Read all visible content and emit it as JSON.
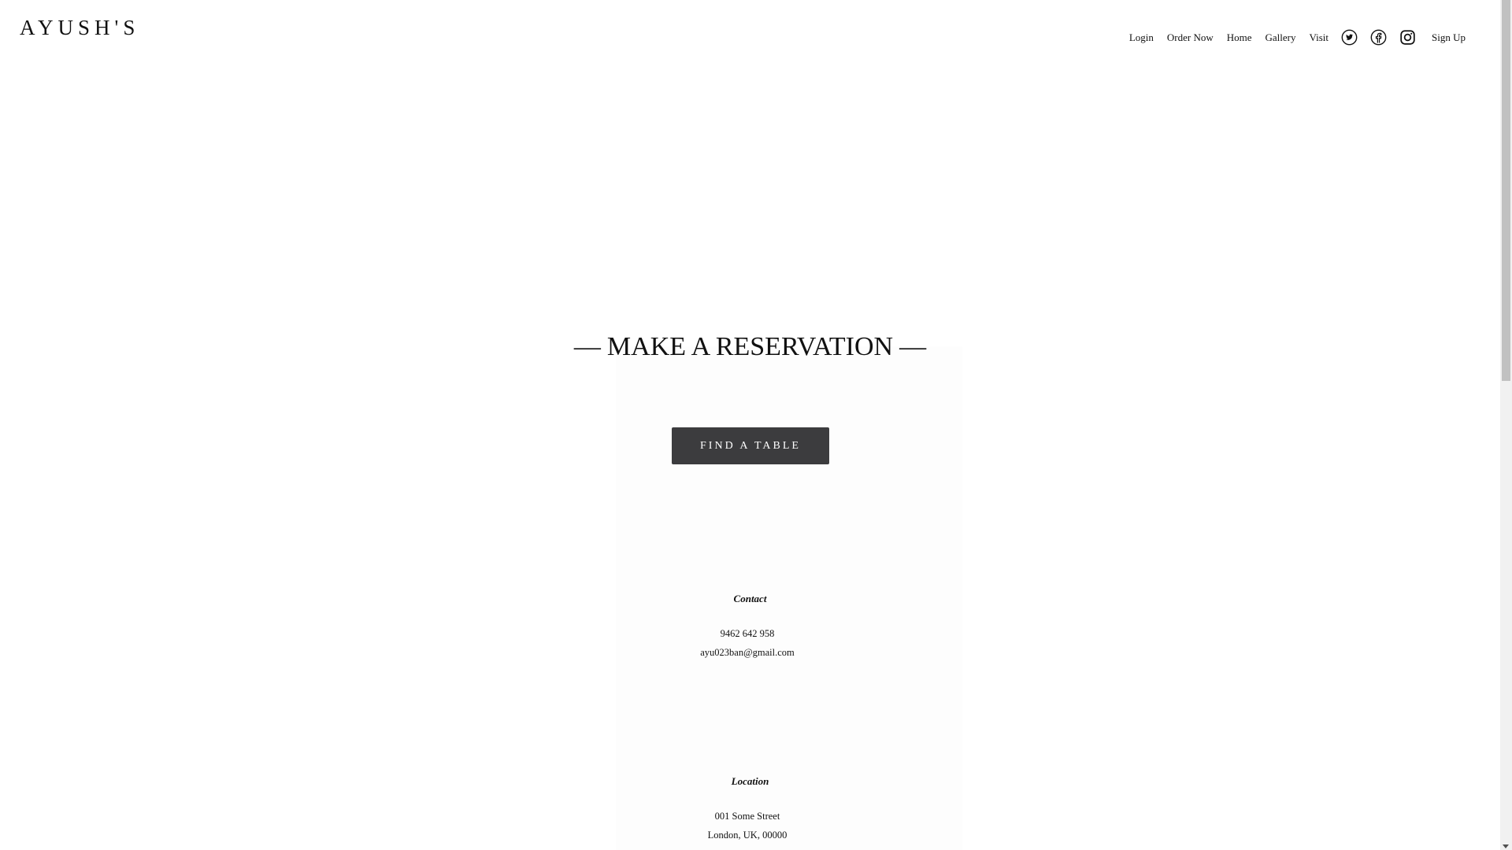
{
  "brand": {
    "logo_text": "AYUSH'S"
  },
  "nav": {
    "links": [
      "Login",
      "Order Now",
      "Home",
      "Gallery",
      "Visit"
    ],
    "social_icons": [
      "twitter-icon",
      "facebook-icon",
      "instagram-icon"
    ],
    "signup_label": "Sign Up"
  },
  "hero": {
    "dash_left": "—",
    "title": "MAKE A RESERVATION",
    "dash_right": "—",
    "button_label": "FIND A TABLE"
  },
  "contact": {
    "heading": "Contact",
    "phone": "9462 642 958",
    "email": "ayu023ban@gmail.com"
  },
  "location": {
    "heading": "Location",
    "street": "001 Some Street",
    "city": "London, UK, 00000"
  },
  "colors": {
    "button_bg": "#3c3c3e",
    "text": "#111111",
    "background": "#ffffff"
  }
}
